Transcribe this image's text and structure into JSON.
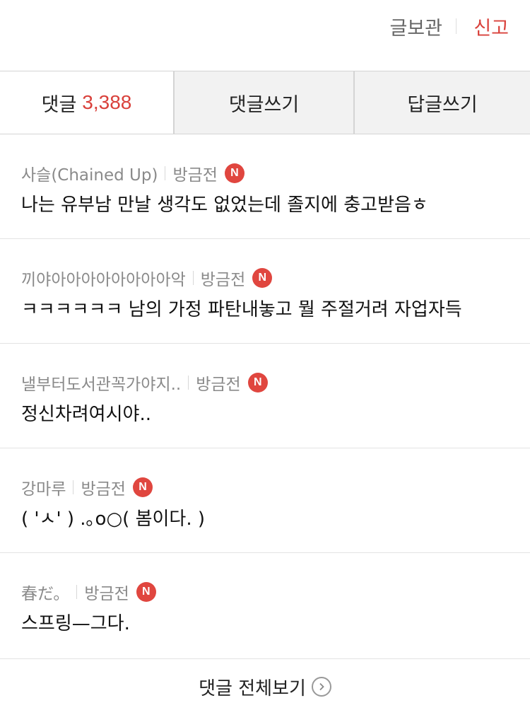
{
  "top_actions": {
    "save_label": "글보관",
    "report_label": "신고"
  },
  "tabs": {
    "comments_label": "댓글",
    "comments_count": "3,388",
    "write_comment_label": "댓글쓰기",
    "write_reply_label": "답글쓰기"
  },
  "comments": [
    {
      "author": "사슬(Chained Up)",
      "time": "방금전",
      "badge": "N",
      "text": "나는 유부남 만날 생각도 없었는데 졸지에 충고받음ㅎ"
    },
    {
      "author": "끼야아아아아아아아아악",
      "time": "방금전",
      "badge": "N",
      "text": "ㅋㅋㅋㅋㅋㅋ 남의 가정 파탄내놓고 뭘 주절거려 자업자득"
    },
    {
      "author": "낼부터도서관꼭가야지..",
      "time": "방금전",
      "badge": "N",
      "text": "정신차려여시야.."
    },
    {
      "author": "강마루",
      "time": "방금전",
      "badge": "N",
      "text": "( 'ㅅ' ) .｡o○( 봄이다. )"
    },
    {
      "author": "春だ。",
      "time": "방금전",
      "badge": "N",
      "text": "스프링—그다."
    }
  ],
  "footer": {
    "view_all_label": "댓글 전체보기"
  },
  "colors": {
    "accent": "#d9413b",
    "badge": "#e0463f",
    "tab_inactive_bg": "#f2f2f2"
  }
}
